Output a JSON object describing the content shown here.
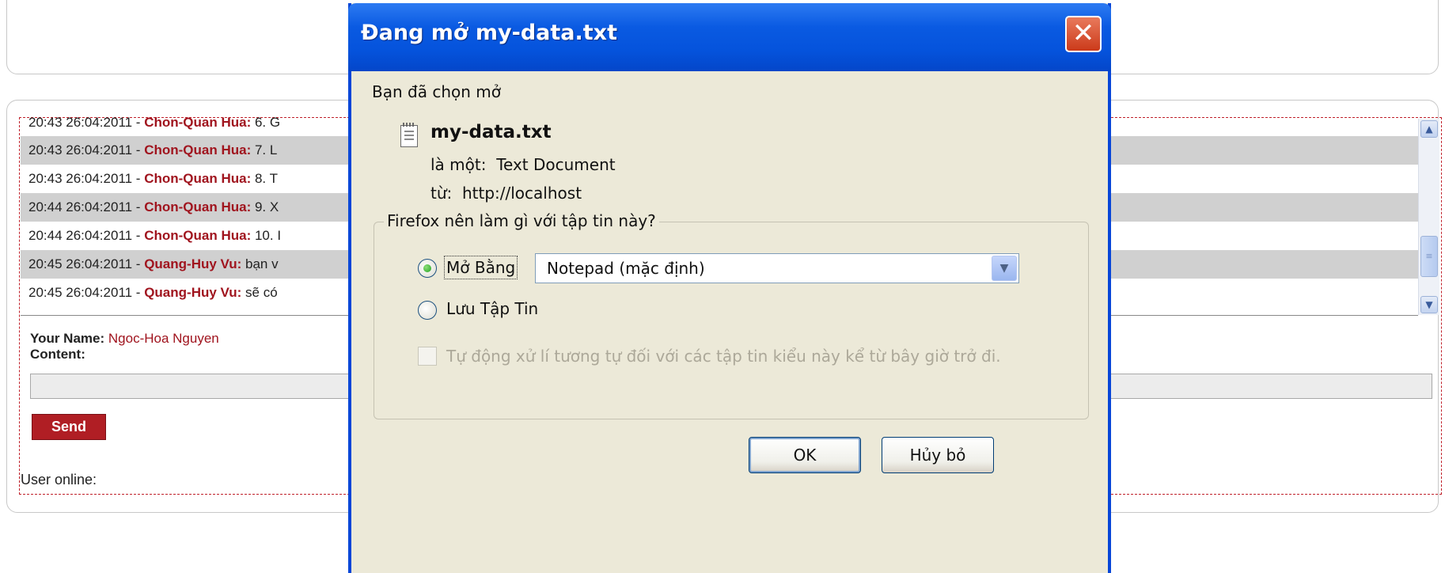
{
  "chat": {
    "messages": [
      {
        "time": "20:43 26:04:2011 - ",
        "author": "Chon-Quan Hua:",
        "text": " 6. G"
      },
      {
        "time": "20:43 26:04:2011 - ",
        "author": "Chon-Quan Hua:",
        "text": " 7. L"
      },
      {
        "time": "20:43 26:04:2011 - ",
        "author": "Chon-Quan Hua:",
        "text": " 8. T"
      },
      {
        "time": "20:44 26:04:2011 - ",
        "author": "Chon-Quan Hua:",
        "text": " 9. X"
      },
      {
        "time": "20:44 26:04:2011 - ",
        "author": "Chon-Quan Hua:",
        "text": " 10. I"
      },
      {
        "time": "20:45 26:04:2011 - ",
        "author": "Quang-Huy Vu:",
        "text": " bạn v"
      },
      {
        "time": "20:45 26:04:2011 - ",
        "author": "Quang-Huy Vu:",
        "text": " sẽ có"
      }
    ],
    "your_name_label": "Your Name:",
    "your_name_value": " Ngoc-Hoa Nguyen",
    "content_label": "Content:",
    "send_label": "Send",
    "user_online_label": "User online:"
  },
  "scrollbar": {
    "up_icon": "▲",
    "down_icon": "▼",
    "thumb_grip": "≡"
  },
  "dialog": {
    "title": "Đang mở my-data.txt",
    "close_glyph": "✕",
    "intro": "Bạn đã chọn mở",
    "filename": "my-data.txt",
    "type_label": "là một:",
    "type_value": "Text Document",
    "from_label": "từ:",
    "from_value": "http://localhost",
    "question": "Firefox nên làm gì với tập tin này?",
    "open_with_label": "Mở Bằng",
    "open_with_value": "Notepad (mặc định)",
    "dropdown_arrow": "▼",
    "save_label": "Lưu Tập Tin",
    "auto_label": "Tự động xử lí tương tự đối với các tập tin kiểu này kể từ bây giờ trở đi.",
    "ok_label": "OK",
    "cancel_label": "Hủy bỏ",
    "open_with_selected": true
  },
  "colors": {
    "accent_red": "#a0141e",
    "xp_blue": "#0846d8",
    "dialog_bg": "#ece9d8"
  }
}
